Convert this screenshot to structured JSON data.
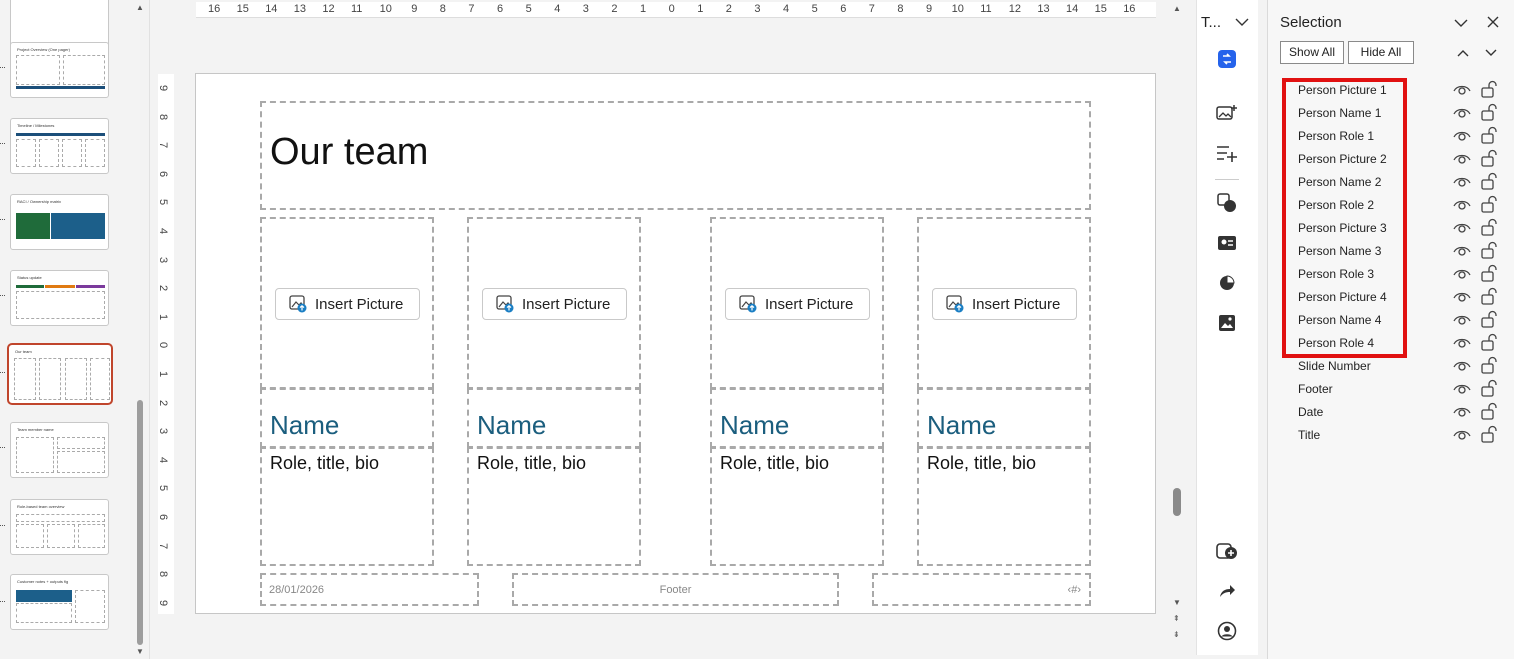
{
  "ruler": {
    "h_labels": [
      "16",
      "15",
      "14",
      "13",
      "12",
      "11",
      "10",
      "9",
      "8",
      "7",
      "6",
      "5",
      "4",
      "3",
      "2",
      "1",
      "0",
      "1",
      "2",
      "3",
      "4",
      "5",
      "6",
      "7",
      "8",
      "9",
      "10",
      "11",
      "12",
      "13",
      "14",
      "15",
      "16"
    ],
    "v_labels": [
      "9",
      "8",
      "7",
      "6",
      "5",
      "4",
      "3",
      "2",
      "1",
      "0",
      "1",
      "2",
      "3",
      "4",
      "5",
      "6",
      "7",
      "8",
      "9"
    ]
  },
  "thumbnails": [
    {
      "title": ""
    },
    {
      "title": "Project Overview (One pager)"
    },
    {
      "title": "Timeline / Milestones"
    },
    {
      "title": "RACI / Ownership matrix"
    },
    {
      "title": "Status update"
    },
    {
      "title": "Our team"
    },
    {
      "title": "Team member name"
    },
    {
      "title": "Role-based team overview"
    },
    {
      "title": "Customer notes + outputs fig"
    }
  ],
  "slide": {
    "title": "Our team",
    "insert_picture_label": "Insert Picture",
    "members": [
      {
        "name": "Name",
        "role": "Role, title, bio"
      },
      {
        "name": "Name",
        "role": "Role, title, bio"
      },
      {
        "name": "Name",
        "role": "Role, title, bio"
      },
      {
        "name": "Name",
        "role": "Role, title, bio"
      }
    ],
    "date": "28/01/2026",
    "footer": "Footer",
    "slide_number": "‹#›"
  },
  "tools": {
    "header": "T..."
  },
  "selection_pane": {
    "title": "Selection",
    "show_all": "Show All",
    "hide_all": "Hide All",
    "items": [
      "Person Picture 1",
      "Person Name 1",
      "Person Role 1",
      "Person Picture 2",
      "Person Name 2",
      "Person Role 2",
      "Person Picture 3",
      "Person Name 3",
      "Person Role 3",
      "Person Picture 4",
      "Person Name 4",
      "Person Role 4",
      "Slide Number",
      "Footer",
      "Date",
      "Title"
    ],
    "highlight_color": "#e11111"
  },
  "colors": {
    "name_text": "#1b5e7e",
    "selected_thumb": "#c0452c",
    "designer_icon": "#2563eb"
  }
}
